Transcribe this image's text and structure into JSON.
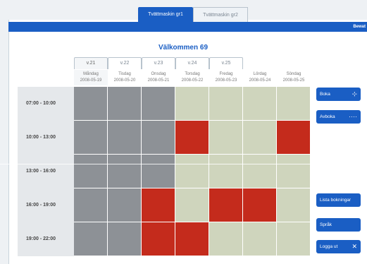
{
  "top_tabs": [
    {
      "label": "Tvättmaskin gr1",
      "active": true
    },
    {
      "label": "Tvättmaskin gr2",
      "active": false
    }
  ],
  "toolbar": {
    "save_label": "Bewat"
  },
  "welcome": "Välkommen 69",
  "weeks": [
    {
      "label": "v.21",
      "active": true
    },
    {
      "label": "v.22",
      "active": false
    },
    {
      "label": "v.23",
      "active": false
    },
    {
      "label": "v.24",
      "active": false
    },
    {
      "label": "v.25",
      "active": false
    }
  ],
  "days": [
    {
      "name": "Måndag",
      "date": "2008-05-19"
    },
    {
      "name": "Tisdag",
      "date": "2008-05-20"
    },
    {
      "name": "Onsdag",
      "date": "2008-05-21"
    },
    {
      "name": "Torsdag",
      "date": "2008-05-22"
    },
    {
      "name": "Fredag",
      "date": "2008-05-23"
    },
    {
      "name": "Lördag",
      "date": "2008-05-24"
    },
    {
      "name": "Söndag",
      "date": "2008-05-25"
    }
  ],
  "times": [
    "07:00 - 10:00",
    "10:00 - 13:00",
    "13:00 - 16:00",
    "16:00 - 19:00",
    "19:00 - 22:00"
  ],
  "slots": [
    [
      "past",
      "past",
      "past",
      "free",
      "free",
      "free",
      "free"
    ],
    [
      "past",
      "past",
      "past",
      "booked",
      "free",
      "free",
      "booked"
    ],
    [
      "past",
      "past",
      "past",
      "free",
      "free",
      "free",
      "free"
    ],
    [
      "past",
      "past",
      "booked",
      "free",
      "booked",
      "booked",
      "free"
    ],
    [
      "past",
      "past",
      "booked",
      "booked",
      "free",
      "free",
      "free"
    ]
  ],
  "side_buttons": [
    {
      "label": "Boka",
      "icon": "⊹"
    },
    {
      "label": "Avboka",
      "icon": "····"
    },
    {
      "label": "Lista bokningar",
      "icon": ""
    },
    {
      "label": "Språk",
      "icon": ""
    },
    {
      "label": "Logga ut",
      "icon": "✕"
    }
  ],
  "colors": {
    "accent": "#1a5ec4",
    "booked": "#c42b1c",
    "free": "#cfd5bd",
    "past": "#8d9196"
  }
}
